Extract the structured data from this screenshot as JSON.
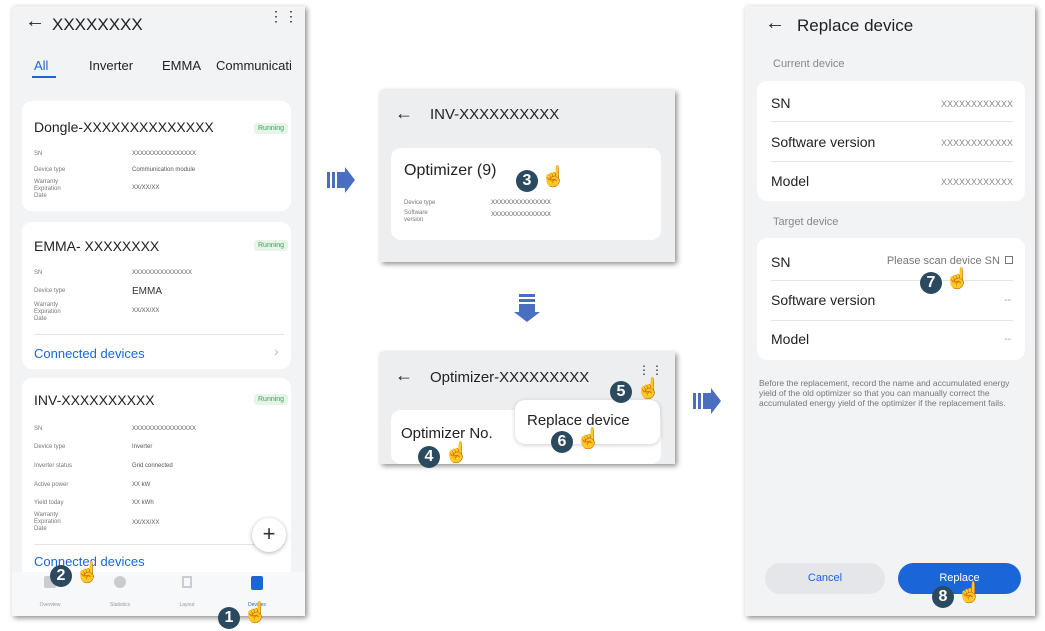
{
  "colors": {
    "accent": "#1a66d8",
    "running": "#3ea05a",
    "badge": "#2c4a5f",
    "arrow": "#4a6fc1"
  },
  "screen1": {
    "title": "XXXXXXXX",
    "tabs": [
      "All",
      "Inverter",
      "EMMA",
      "Communicati"
    ],
    "dongle": {
      "name": "Dongle-XXXXXXXXXXXXXX",
      "status": "Running",
      "rows": [
        {
          "label": "SN",
          "value": "XXXXXXXXXXXXXXXX"
        },
        {
          "label": "Device type",
          "value": "Communication module"
        },
        {
          "label": "Warranty Expiration Date",
          "value": "XX/XX/XX"
        }
      ]
    },
    "emma": {
      "name": "EMMA- XXXXXXXX",
      "status": "Running",
      "rows": [
        {
          "label": "SN",
          "value": "XXXXXXXXXXXXXXX"
        },
        {
          "label": "Device type",
          "value": "EMMA"
        },
        {
          "label": "Warranty Expiration Date",
          "value": "XX/XX/XX"
        }
      ],
      "link": "Connected devices"
    },
    "inv": {
      "name": "INV-XXXXXXXXXX",
      "status": "Running",
      "rows": [
        {
          "label": "SN",
          "value": "XXXXXXXXXXXXXXXX"
        },
        {
          "label": "Device type",
          "value": "Inverter"
        },
        {
          "label": "Inverter status",
          "value": "Grid connected"
        },
        {
          "label": "Active power",
          "value": "XX kW"
        },
        {
          "label": "Yield today",
          "value": "XX kWh"
        },
        {
          "label": "Warranty Expiration Date",
          "value": "XX/XX/XX"
        }
      ],
      "link": "Connected devices"
    },
    "fab": "+",
    "nav": [
      "Overview",
      "Statistics",
      "Layout",
      "Devices"
    ]
  },
  "screen2": {
    "title": "INV-XXXXXXXXXX",
    "card_title": "Optimizer (9)",
    "rows": [
      {
        "label": "Device type",
        "value": "XXXXXXXXXXXXXXX"
      },
      {
        "label": "Software version",
        "value": "XXXXXXXXXXXXXXX"
      }
    ]
  },
  "screen3": {
    "title": "Optimizer-XXXXXXXXX",
    "field": "Optimizer No.",
    "menu_item": "Replace device"
  },
  "screen4": {
    "title": "Replace device",
    "current_header": "Current device",
    "current": [
      {
        "label": "SN",
        "value": "XXXXXXXXXXXX"
      },
      {
        "label": "Software version",
        "value": "XXXXXXXXXXXX"
      },
      {
        "label": "Model",
        "value": "XXXXXXXXXXXX"
      }
    ],
    "target_header": "Target device",
    "target": [
      {
        "label": "SN",
        "value": "Please scan device SN"
      },
      {
        "label": "Software version",
        "value": "--"
      },
      {
        "label": "Model",
        "value": "--"
      }
    ],
    "note": "Before the replacement, record the name and accumulated energy yield of the old optimizer so that you can manually correct the accumulated energy yield of the optimizer if the replacement fails.",
    "cancel": "Cancel",
    "replace": "Replace"
  },
  "steps": [
    "1",
    "2",
    "3",
    "4",
    "5",
    "6",
    "7",
    "8"
  ]
}
